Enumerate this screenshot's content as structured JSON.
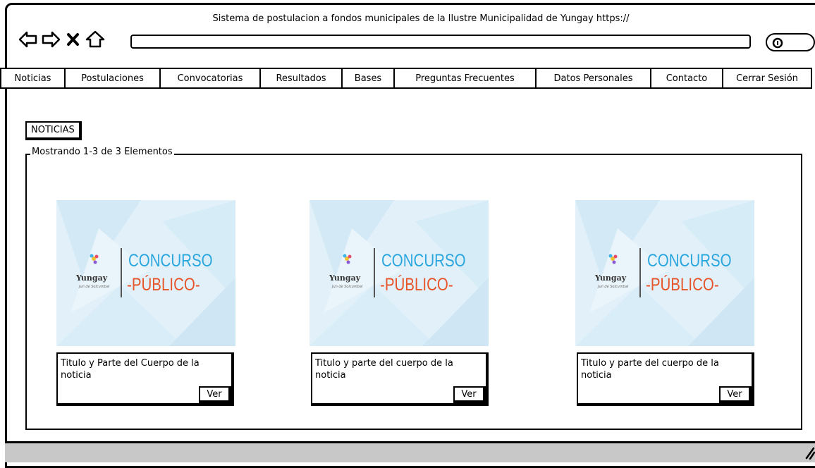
{
  "browser": {
    "window_title": "Sistema de postulacion a fondos municipales de la Ilustre Municipalidad de Yungay https://",
    "url_value": "",
    "icons": [
      "back-arrow-icon",
      "forward-arrow-icon",
      "close-x-icon",
      "home-icon",
      "search-icon"
    ]
  },
  "menu": {
    "items": [
      {
        "label": "Noticias"
      },
      {
        "label": "Postulaciones"
      },
      {
        "label": "Convocatorias"
      },
      {
        "label": "Resultados"
      },
      {
        "label": "Bases"
      },
      {
        "label": "Preguntas Frecuentes"
      },
      {
        "label": "Datos Personales"
      },
      {
        "label": "Contacto"
      },
      {
        "label": "Cerrar Sesión"
      }
    ]
  },
  "main": {
    "section_title": "NOTICIAS",
    "group_label": "Mostrando 1-3 de 3 Elementos",
    "cards": [
      {
        "logo_text": "Yungay",
        "logo_tagline": "Jun de Solcumbal",
        "banner_line1": "CONCURSO",
        "banner_line2": "-PÚBLICO-",
        "description": "Titulo y Parte del Cuerpo de la noticia",
        "button_label": "Ver"
      },
      {
        "logo_text": "Yungay",
        "logo_tagline": "Jun de Solcumbal",
        "banner_line1": "CONCURSO",
        "banner_line2": "-PÚBLICO-",
        "description": "Titulo y parte del cuerpo de la noticia",
        "button_label": "Ver"
      },
      {
        "logo_text": "Yungay",
        "logo_tagline": "Jun de Solcumbal",
        "banner_line1": "CONCURSO",
        "banner_line2": "-PÚBLICO-",
        "description": "Titulo y parte del cuerpo de la noticia",
        "button_label": "Ver"
      }
    ]
  },
  "colors": {
    "banner_blue": "#2aa6de",
    "banner_orange": "#e8542a",
    "banner_bg": "#e2f1f9",
    "statusbar": "#c8c8c8"
  }
}
